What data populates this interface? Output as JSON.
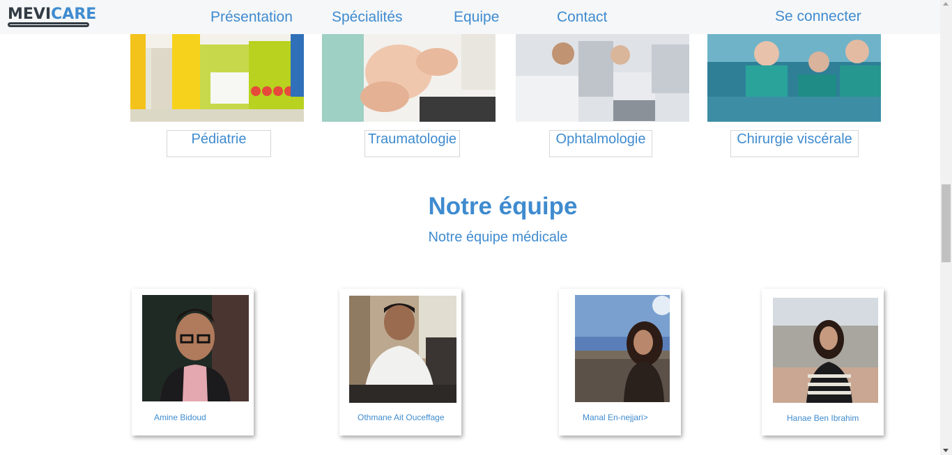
{
  "header": {
    "logo": {
      "part1": "MEVI",
      "part2": "CARE"
    },
    "nav": [
      "Présentation",
      "Spécialités",
      "Equipe",
      "Contact"
    ],
    "login": "Se connecter"
  },
  "specialties": [
    {
      "label": "Pédiatrie"
    },
    {
      "label": "Traumatologie"
    },
    {
      "label": "Ophtalmologie"
    },
    {
      "label": "Chirurgie viscérale"
    }
  ],
  "team": {
    "title": "Notre équipe",
    "subtitle": "Notre équipe médicale",
    "members": [
      {
        "name": "Amine Bidoud"
      },
      {
        "name": "Othmane Ait Oucеffage"
      },
      {
        "name": "Manal En-nejjari>"
      },
      {
        "name": "Hanae Ben Ibrahim"
      }
    ]
  },
  "colors": {
    "accent": "#3f8bcf",
    "header_bg": "#f5f7f8",
    "logo_dark": "#333b44"
  }
}
